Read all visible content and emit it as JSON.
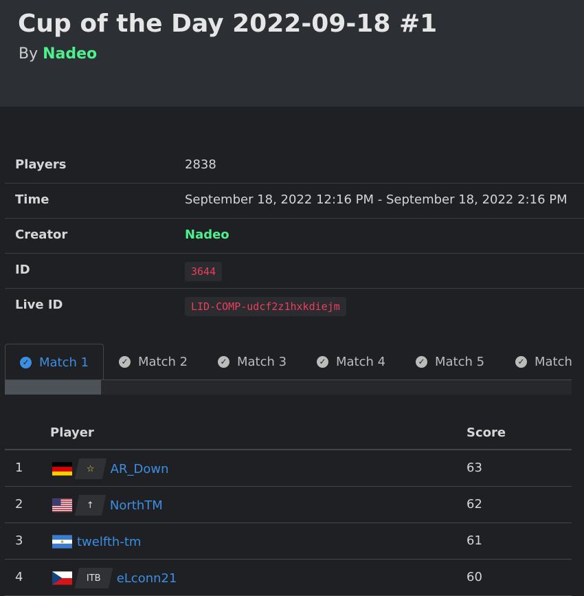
{
  "header": {
    "title": "Cup of the Day 2022-09-18 #1",
    "by_label": "By",
    "creator": "Nadeo"
  },
  "info": {
    "players_label": "Players",
    "players_value": "2838",
    "time_label": "Time",
    "time_value": "September 18, 2022 12:16 PM - September 18, 2022 2:16 PM",
    "creator_label": "Creator",
    "creator_value": "Nadeo",
    "id_label": "ID",
    "id_value": "3644",
    "live_id_label": "Live ID",
    "live_id_value": "LID-COMP-udcf2z1hxkdiejm"
  },
  "tabs": [
    {
      "label": "Match 1",
      "active": true
    },
    {
      "label": "Match 2",
      "active": false
    },
    {
      "label": "Match 3",
      "active": false
    },
    {
      "label": "Match 4",
      "active": false
    },
    {
      "label": "Match 5",
      "active": false
    },
    {
      "label": "Match",
      "active": false
    }
  ],
  "progress": {
    "fraction": 0.17
  },
  "table": {
    "col_player": "Player",
    "col_score": "Score",
    "rows": [
      {
        "rank": "1",
        "flag": "germany-flag",
        "tag": "☆",
        "name": "AR_Down",
        "score": "63"
      },
      {
        "rank": "2",
        "flag": "usa-flag",
        "tag": "↑",
        "name": "NorthTM",
        "score": "62"
      },
      {
        "rank": "3",
        "flag": "nicaragua-flag",
        "tag": "",
        "name": "twelfth-tm",
        "score": "61"
      },
      {
        "rank": "4",
        "flag": "czech-flag",
        "tag": "ITB",
        "name": "eLconn21",
        "score": "60"
      }
    ]
  },
  "colors": {
    "accent_blue": "#3c8ee2",
    "creator_green": "#4ef08c",
    "code_red": "#ee3d5f",
    "background": "#1f2023",
    "header_bg": "#2c2f33"
  }
}
